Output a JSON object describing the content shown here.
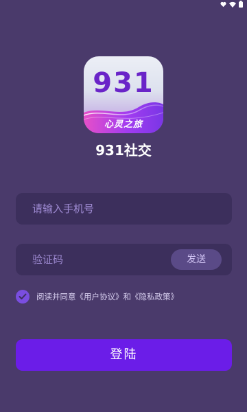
{
  "logo": {
    "number": "931",
    "slogan": "心灵之旅"
  },
  "app": {
    "name": "931社交"
  },
  "form": {
    "phone_placeholder": "请输入手机号",
    "code_placeholder": "验证码",
    "send_label": "发送"
  },
  "agreement": {
    "checked": true,
    "prefix": "阅读并同意",
    "user_agreement": "《用户协议》",
    "conjunction": "和",
    "privacy_policy": "《隐私政策》"
  },
  "login_label": "登陆",
  "status_bar": {
    "icons": [
      "heart-icon",
      "wifi-icon",
      "battery-icon"
    ]
  },
  "colors": {
    "background": "#4a3a6b",
    "field": "#3c2f5c",
    "primary": "#6b1de8",
    "checkbox": "#7a4ee0"
  }
}
